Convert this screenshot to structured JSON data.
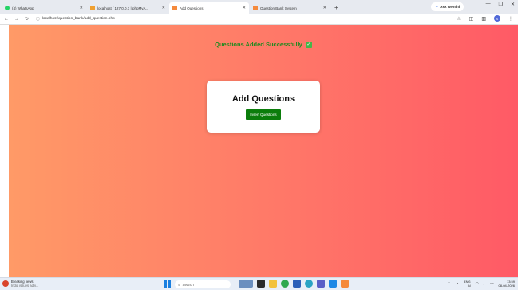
{
  "browser": {
    "tabs": [
      {
        "title": "(4) WhatsApp",
        "favicon_color": "#25D366",
        "active": false
      },
      {
        "title": "localhost / 127.0.0.1 | phpMyA...",
        "favicon_color": "#f0a030",
        "active": false
      },
      {
        "title": "Add Questions",
        "favicon_color": "#f58a3c",
        "active": true
      },
      {
        "title": "Question Bank System",
        "favicon_color": "#f58a3c",
        "active": false
      }
    ],
    "new_tab": "+",
    "gemini_label": "Ask Gemini",
    "url": "localhost/question_bank/add_question.php",
    "profile_initial": "S"
  },
  "page": {
    "success_message": "Questions Added Successfully",
    "card_title": "Add Questions",
    "insert_button": "Insert Questions",
    "gradient_start": "#ff9a67",
    "gradient_end": "#ff5a66",
    "success_color": "#1f8a1f",
    "button_color": "#0b7d0b"
  },
  "taskbar": {
    "news_title": "Breaking news",
    "news_sub": "India issues advi...",
    "search_placeholder": "Search",
    "app_icons": [
      "mountain-app-icon",
      "taskview-icon",
      "file-explorer-icon",
      "chrome-icon",
      "store-icon",
      "edge-icon",
      "teams-icon",
      "vscode-icon",
      "app-icon"
    ],
    "language": "ENG",
    "region": "IN",
    "time": "13:59",
    "date": "08-04-2026"
  }
}
